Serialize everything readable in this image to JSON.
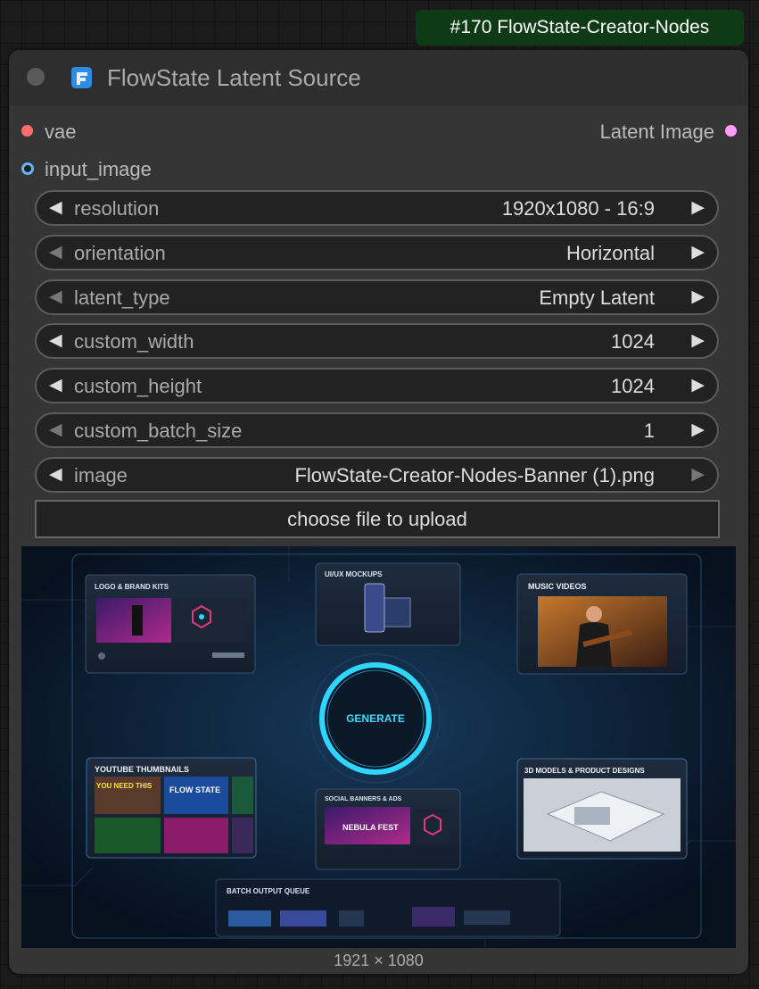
{
  "badge": {
    "text": "#170 FlowState-Creator-Nodes"
  },
  "node": {
    "title": "FlowState Latent Source",
    "icon": "flowstate-logo-icon",
    "inputs": [
      {
        "name": "vae",
        "color": "#ff6e6e"
      },
      {
        "name": "input_image",
        "color": "#64b5f6"
      }
    ],
    "outputs": [
      {
        "name": "Latent Image",
        "color": "#ff9cf9"
      }
    ],
    "widgets": [
      {
        "label": "resolution",
        "value": "1920x1080 - 16:9"
      },
      {
        "label": "orientation",
        "value": "Horizontal"
      },
      {
        "label": "latent_type",
        "value": "Empty Latent"
      },
      {
        "label": "custom_width",
        "value": "1024"
      },
      {
        "label": "custom_height",
        "value": "1024"
      },
      {
        "label": "custom_batch_size",
        "value": "1"
      },
      {
        "label": "image",
        "value": "FlowState-Creator-Nodes-Banner (1).png"
      }
    ],
    "upload_button": "choose file to upload",
    "preview": {
      "panels": {
        "logo": "LOGO & BRAND KITS",
        "uiux": "UI/UX MOCKUPS",
        "music": "MUSIC VIDEOS",
        "youtube": "YOUTUBE THUMBNAILS",
        "social": "SOCIAL BANNERS & ADS",
        "models": "3D MODELS & PRODUCT DESIGNS",
        "batch": "BATCH OUTPUT QUEUE"
      },
      "generate": "GENERATE",
      "thumb_texts": {
        "yt1": "YOU NEED THIS",
        "yt2": "FLOW STATE",
        "nebula": "NEBULA FEST"
      }
    },
    "image_size": "1921 × 1080"
  },
  "colors": {
    "badge_bg": "#0e3a16",
    "node_bg": "#353535",
    "widget_bg": "#222222",
    "banner_bg": "#0a1526",
    "accent_cyan": "#2fd6ff"
  }
}
